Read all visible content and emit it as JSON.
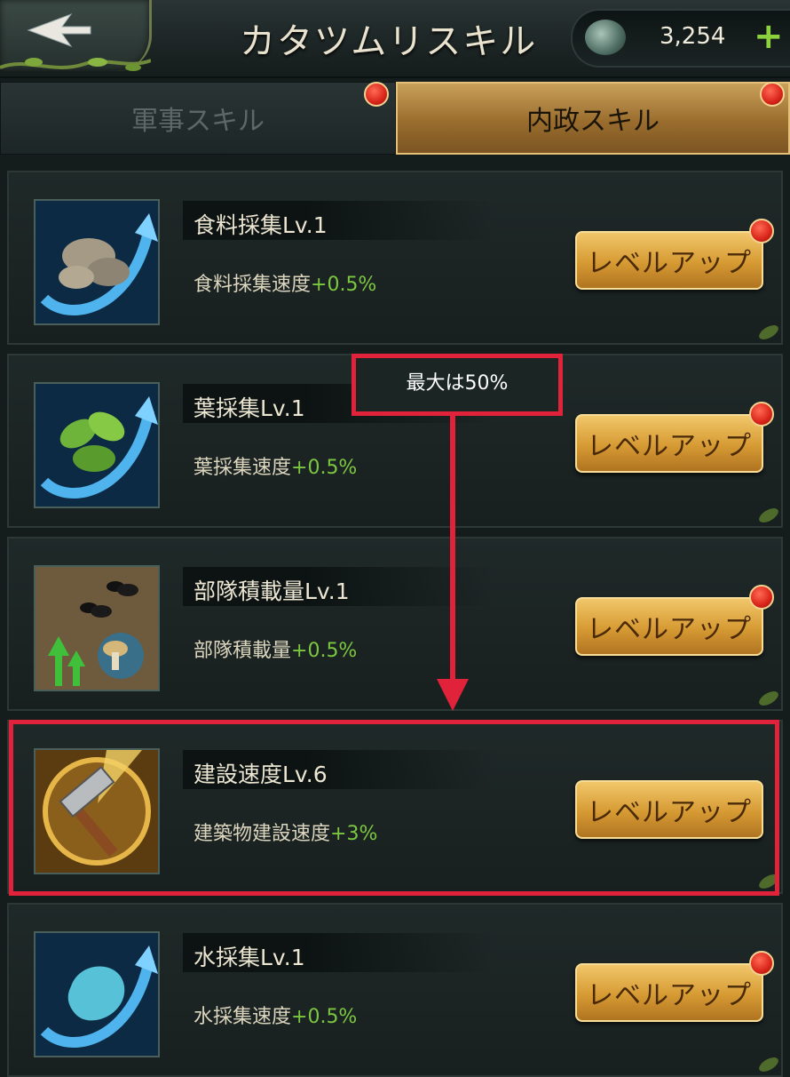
{
  "header": {
    "title": "カタツムリスキル",
    "currency_amount": "3,254",
    "plus_label": "+"
  },
  "tabs": [
    {
      "label": "軍事スキル",
      "active": false,
      "badge": true
    },
    {
      "label": "内政スキル",
      "active": true,
      "badge": true
    }
  ],
  "skills": [
    {
      "name": "食料採集Lv.1",
      "desc": "食料採集速度",
      "bonus": "+0.5%",
      "button": "レベルアップ",
      "badge": true,
      "icon": "pill-bug-icon"
    },
    {
      "name": "葉採集Lv.1",
      "desc": "葉採集速度",
      "bonus": "+0.5%",
      "button": "レベルアップ",
      "badge": true,
      "icon": "leaf-icon"
    },
    {
      "name": "部隊積載量Lv.1",
      "desc": "部隊積載量",
      "bonus": "+0.5%",
      "button": "レベルアップ",
      "badge": true,
      "icon": "ant-icon"
    },
    {
      "name": "建設速度Lv.6",
      "desc": "建築物建設速度",
      "bonus": "+3%",
      "button": "レベルアップ",
      "badge": false,
      "icon": "hammer-icon"
    },
    {
      "name": "水採集Lv.1",
      "desc": "水採集速度",
      "bonus": "+0.5%",
      "button": "レベルアップ",
      "badge": true,
      "icon": "water-drop-icon"
    }
  ],
  "annotation": {
    "note": "最大は50%",
    "color": "#e0223a"
  }
}
